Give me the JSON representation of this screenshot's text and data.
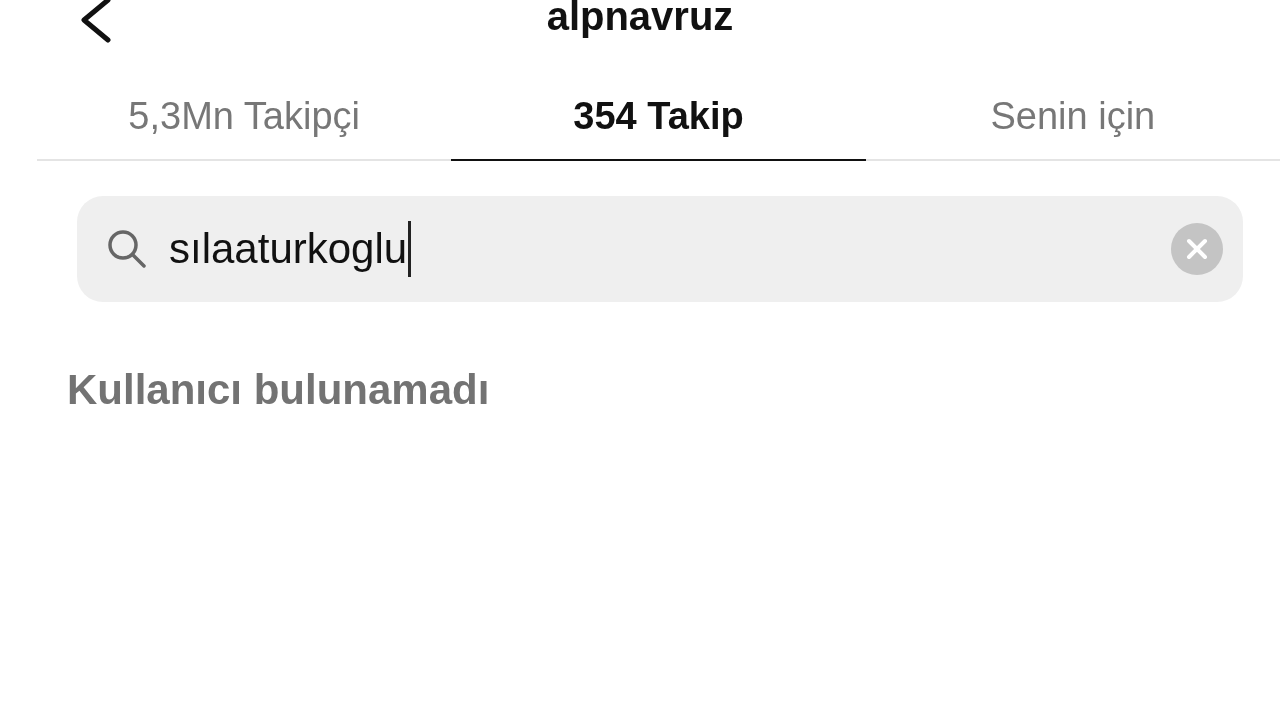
{
  "header": {
    "title": "alpnavruz"
  },
  "tabs": [
    {
      "label": "5,3Mn Takipçi",
      "selected": false
    },
    {
      "label": "354 Takip",
      "selected": true
    },
    {
      "label": "Senin için",
      "selected": false
    }
  ],
  "search": {
    "value": "sılaaturkoglu",
    "focused": true
  },
  "empty_message": "Kullanıcı bulunamadı"
}
